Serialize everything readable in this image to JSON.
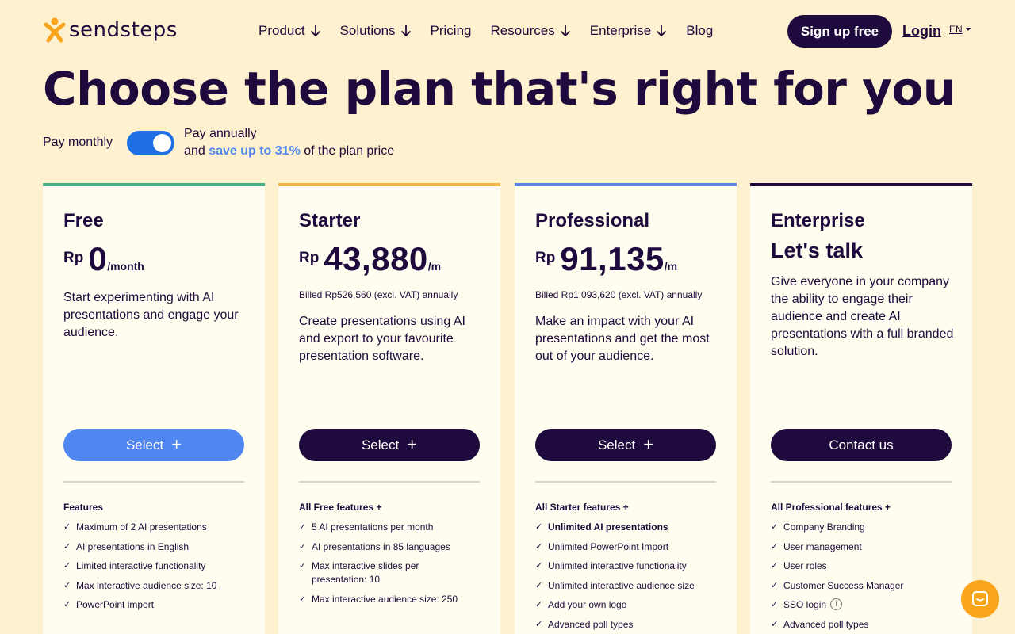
{
  "brand": {
    "name": "sendsteps"
  },
  "nav": {
    "items": [
      {
        "label": "Product",
        "has_arrow": true
      },
      {
        "label": "Solutions",
        "has_arrow": true
      },
      {
        "label": "Pricing",
        "has_arrow": false
      },
      {
        "label": "Resources",
        "has_arrow": true
      },
      {
        "label": "Enterprise",
        "has_arrow": true
      },
      {
        "label": "Blog",
        "has_arrow": false
      }
    ],
    "signup": "Sign up free",
    "login": "Login",
    "lang": "EN"
  },
  "page": {
    "title": "Choose the plan that's right for you",
    "billing": {
      "monthly": "Pay monthly",
      "annual_line1": "Pay annually",
      "annual_and": "and ",
      "annual_save": "save up to 31%",
      "annual_rest": " of the plan price",
      "annual_selected": true
    }
  },
  "plans": [
    {
      "name": "Free",
      "currency": "Rp",
      "amount": "0",
      "period": "/month",
      "billed": "",
      "description": "Start experimenting with AI presentations and engage your audience.",
      "button": "Select",
      "features_heading": "Features",
      "features": [
        {
          "text": "Maximum of 2 AI presentations",
          "bold": false
        },
        {
          "text": "AI presentations in English",
          "bold": false
        },
        {
          "text": "Limited interactive functionality",
          "bold": false
        },
        {
          "text": "Max interactive audience size: 10",
          "bold": false
        },
        {
          "text": "PowerPoint import",
          "bold": false
        }
      ]
    },
    {
      "name": "Starter",
      "currency": "Rp",
      "amount": "43,880",
      "period": "/m",
      "billed": "Billed Rp526,560 (excl. VAT) annually",
      "description": "Create presentations using AI and export to your favourite presentation software.",
      "button": "Select",
      "features_heading": "All Free features +",
      "features": [
        {
          "text": "5 AI presentations per month",
          "bold": false
        },
        {
          "text": "AI presentations in 85 languages",
          "bold": false
        },
        {
          "text": "Max interactive slides per presentation: 10",
          "bold": false
        },
        {
          "text": "Max interactive audience size: 250",
          "bold": false
        }
      ]
    },
    {
      "name": "Professional",
      "currency": "Rp",
      "amount": "91,135",
      "period": "/m",
      "billed": "Billed Rp1,093,620 (excl. VAT) annually",
      "description": "Make an impact with your AI presentations and get the most out of your audience.",
      "button": "Select",
      "features_heading": "All Starter features +",
      "features": [
        {
          "text": "Unlimited AI presentations",
          "bold": true
        },
        {
          "text": "Unlimited PowerPoint Import",
          "bold": false
        },
        {
          "text": "Unlimited interactive functionality",
          "bold": false
        },
        {
          "text": "Unlimited interactive audience size",
          "bold": false
        },
        {
          "text": "Add your own logo",
          "bold": false
        },
        {
          "text": "Advanced poll types",
          "bold": false
        }
      ]
    },
    {
      "name": "Enterprise",
      "subtitle": "Let's talk",
      "description": "Give everyone in your company the ability to engage their audience and create AI presentations with a full branded solution.",
      "button": "Contact us",
      "features_heading": "All Professional features +",
      "features": [
        {
          "text": "Company Branding",
          "bold": false
        },
        {
          "text": "User management",
          "bold": false
        },
        {
          "text": "User roles",
          "bold": false
        },
        {
          "text": "Customer Success Manager",
          "bold": false
        },
        {
          "text": "SSO login",
          "bold": false,
          "info": true
        },
        {
          "text": "Advanced poll types",
          "bold": false
        }
      ]
    }
  ],
  "colors": {
    "free_accent": "#3fae83",
    "starter_accent": "#f4b942",
    "professional_accent": "#5b83e6",
    "enterprise_accent": "#1e0a3c",
    "select_blue": "#4f86f0",
    "dark": "#1e0a3c",
    "background": "#fdf1cf",
    "chat": "#f8a51c"
  }
}
